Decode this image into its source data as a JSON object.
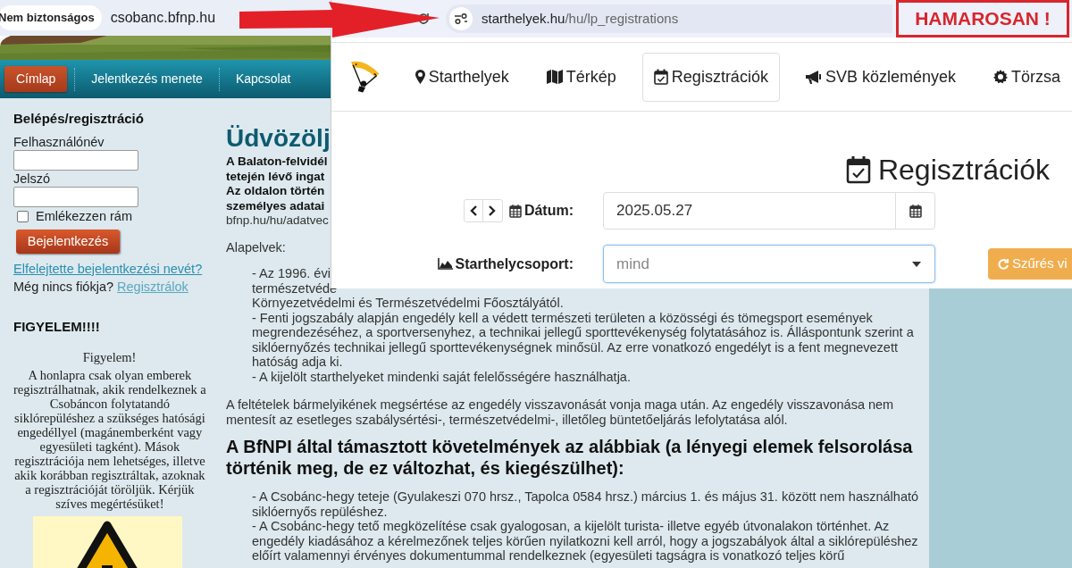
{
  "left_browser": {
    "security_label": "Nem biztonságos",
    "url": "csobanc.bfnp.hu"
  },
  "left_site": {
    "nav": [
      {
        "label": "Címlap",
        "selected": true
      },
      {
        "label": "Jelentkezés menete",
        "selected": false
      },
      {
        "label": "Kapcsolat",
        "selected": false
      }
    ],
    "login": {
      "title": "Belépés/regisztráció",
      "username_label": "Felhasználónév",
      "password_label": "Jelszó",
      "remember_label": "Emlékezzen rám",
      "remember_checked": false,
      "submit": "Bejelentkezés",
      "forgot_link": "Elfelejtette bejelentkezési nevét?",
      "no_account": "Még nincs fiókja?",
      "register_link": "Regisztrálok"
    },
    "notice": {
      "title": "FIGYELEM!!!!",
      "heading": "Figyelem!",
      "lines": [
        "A honlapra csak olyan emberek",
        "regisztrálhatnak, akik rendelkeznek a",
        "Csobáncon folytatandó",
        "siklórepüléshez a szükséges hatósági",
        "engedéllyel (magánemberként vagy",
        "egyesületi tagként). Mások",
        "regisztrációja nem lehetséges, illetve",
        "akik korábban regisztráltak, azoknak",
        "a regisztrációját töröljük. Kérjük",
        "szíves megértésüket!"
      ]
    },
    "main": {
      "heading": "Üdvözölj",
      "intro": [
        {
          "text": "A Balaton-felvidél",
          "bold": true
        },
        {
          "text": "tetején lévő ingat",
          "bold": true
        },
        {
          "text": "Az oldalon történ",
          "bold": true
        },
        {
          "text": "személyes adatai",
          "bold": true
        },
        {
          "text": "bfnp.hu/hu/adatvec",
          "bold": false
        }
      ],
      "principles_label": "Alapelvek:",
      "principles": [
        [
          "- Az 1996. évi",
          "természetvéde",
          "Környezetvédelmi és Természetvédelmi Főosztályától."
        ],
        [
          "- Fenti jogszabály alapján engedély kell a védett természeti területen a közösségi és tömegsport események",
          "megrendezéséhez, a sportversenyhez, a technikai jellegű sporttevékenység folytatásához is. Álláspontunk szerint a",
          "siklóernyőzés technikai jellegű sporttevékenységnek minősül. Az erre vonatkozó engedélyt is a fent megnevezett",
          "hatóság adja ki."
        ],
        [
          "- A kijelölt starthelyeket mindenki saját felelősségére használhatja."
        ]
      ],
      "conditions": [
        "A feltételek bármelyikének megsértése az engedély visszavonását vonja maga után. Az engedély visszavonása nem",
        "mentesít az esetleges szabálysértési-, természetvédelmi-, illetőleg büntetőeljárás lefolytatása alól."
      ],
      "requirements_heading": [
        "A BfNPI által támasztott követelmények az alábbiak (a lényegi elemek felsorolása",
        "történik meg, de ez változhat, és kiegészülhet):"
      ],
      "requirements": [
        [
          "- A Csobánc-hegy teteje (Gyulakeszi 070 hrsz., Tapolca 0584 hrsz.) március 1. és május 31. között nem használható",
          "siklóernyős repüléshez."
        ],
        [
          "- A Csobánc-hegy tető megközelítése csak gyalogosan, a kijelölt turista- illetve egyéb útvonalakon történhet. Az",
          "engedély kiadásához a kérelmezőnek teljes körűen nyilatkozni kell arról, hogy a jogszabályok által a siklórepüléshez",
          "előírt valamennyi érvényes dokumentummal rendelkeznek (egyesületi tagságra is vonatkozó teljes körű"
        ]
      ]
    }
  },
  "right_browser": {
    "url_host": "starthelyek.hu",
    "url_path": "/hu/lp_registrations"
  },
  "announcement": "HAMAROSAN !",
  "app": {
    "nav": [
      {
        "label": "Starthelyek",
        "kind": "marker",
        "selected": false
      },
      {
        "label": "Térkép",
        "kind": "map",
        "selected": false
      },
      {
        "label": "Regisztrációk",
        "kind": "calendar",
        "selected": true
      },
      {
        "label": "SVB közlemények",
        "kind": "megaphone",
        "selected": false
      },
      {
        "label": "Törzsa",
        "kind": "gear",
        "selected": false
      }
    ],
    "title": "Regisztrációk",
    "date_label": "Dátum:",
    "date_value": "2025.05.27",
    "group_label": "Starthelycsoport:",
    "group_value": "mind",
    "filter_button": "Szűrés vi"
  }
}
